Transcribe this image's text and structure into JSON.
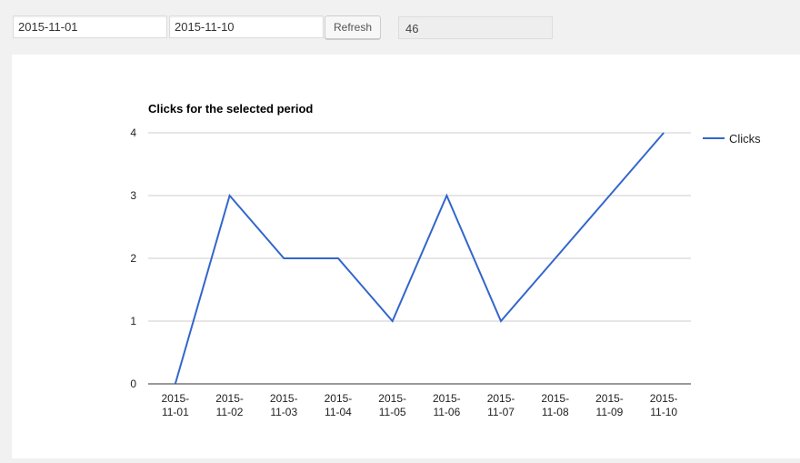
{
  "toolbar": {
    "start_date": "2015-11-01",
    "end_date": "2015-11-10",
    "refresh_label": "Refresh",
    "total_clicks": "46"
  },
  "colors": {
    "series": "#3366cc",
    "grid": "#cccccc",
    "axis": "#333333"
  },
  "chart_data": {
    "type": "line",
    "title": "Clicks for the selected period",
    "xlabel": "",
    "ylabel": "",
    "legend_position": "right",
    "grid": true,
    "ylim": [
      0,
      4
    ],
    "yticks": [
      0,
      1,
      2,
      3,
      4
    ],
    "categories": [
      "2015-11-01",
      "2015-11-02",
      "2015-11-03",
      "2015-11-04",
      "2015-11-05",
      "2015-11-06",
      "2015-11-07",
      "2015-11-08",
      "2015-11-09",
      "2015-11-10"
    ],
    "series": [
      {
        "name": "Clicks",
        "values": [
          0,
          3,
          2,
          2,
          1,
          3,
          1,
          2,
          3,
          4
        ]
      }
    ]
  }
}
